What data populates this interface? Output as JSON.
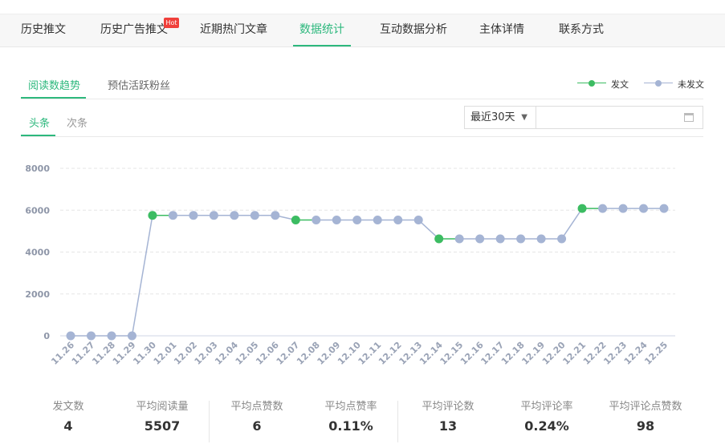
{
  "nav": {
    "tabs": [
      "历史推文",
      "历史广告推文",
      "近期热门文章",
      "数据统计",
      "互动数据分析",
      "主体详情",
      "联系方式"
    ],
    "active": "数据统计",
    "hot_badge": "Hot"
  },
  "subtabs": {
    "items": [
      "阅读数趋势",
      "预估活跃粉丝"
    ],
    "active": "阅读数趋势"
  },
  "type_tabs": {
    "items": [
      "头条",
      "次条"
    ],
    "active": "头条"
  },
  "filter": {
    "range": "最近30天",
    "date_value": ""
  },
  "legend": {
    "posted": {
      "label": "发文",
      "color": "#3cbc62"
    },
    "not_posted": {
      "label": "未发文",
      "color": "#a5b4d4"
    }
  },
  "colors": {
    "accent": "#2db87d"
  },
  "chart_data": {
    "type": "line",
    "title": "",
    "xlabel": "",
    "ylabel": "",
    "ylim": [
      0,
      8000
    ],
    "yticks": [
      0,
      2000,
      4000,
      6000,
      8000
    ],
    "grid": true,
    "legend_position": "top-right",
    "x": [
      "11.26",
      "11.27",
      "11.28",
      "11.29",
      "11.30",
      "12.01",
      "12.02",
      "12.03",
      "12.04",
      "12.05",
      "12.06",
      "12.07",
      "12.08",
      "12.09",
      "12.10",
      "12.11",
      "12.12",
      "12.13",
      "12.14",
      "12.15",
      "12.16",
      "12.17",
      "12.18",
      "12.19",
      "12.20",
      "12.21",
      "12.22",
      "12.23",
      "12.24",
      "12.25"
    ],
    "series": [
      {
        "name": "",
        "values": [
          0,
          0,
          0,
          0,
          5750,
          5750,
          5750,
          5750,
          5750,
          5750,
          5750,
          5530,
          5530,
          5530,
          5530,
          5530,
          5530,
          5530,
          4630,
          4630,
          4630,
          4630,
          4630,
          4630,
          4630,
          6080,
          6080,
          6080,
          6080,
          6080
        ],
        "posted": [
          false,
          false,
          false,
          false,
          true,
          false,
          false,
          false,
          false,
          false,
          false,
          true,
          false,
          false,
          false,
          false,
          false,
          false,
          true,
          false,
          false,
          false,
          false,
          false,
          false,
          true,
          false,
          false,
          false,
          false
        ]
      }
    ]
  },
  "stats": [
    {
      "label": "发文数",
      "value": "4"
    },
    {
      "label": "平均阅读量",
      "value": "5507"
    },
    {
      "label": "平均点赞数",
      "value": "6"
    },
    {
      "label": "平均点赞率",
      "value": "0.11%"
    },
    {
      "label": "平均评论数",
      "value": "13"
    },
    {
      "label": "平均评论率",
      "value": "0.24%"
    },
    {
      "label": "平均评论点赞数",
      "value": "98"
    }
  ]
}
